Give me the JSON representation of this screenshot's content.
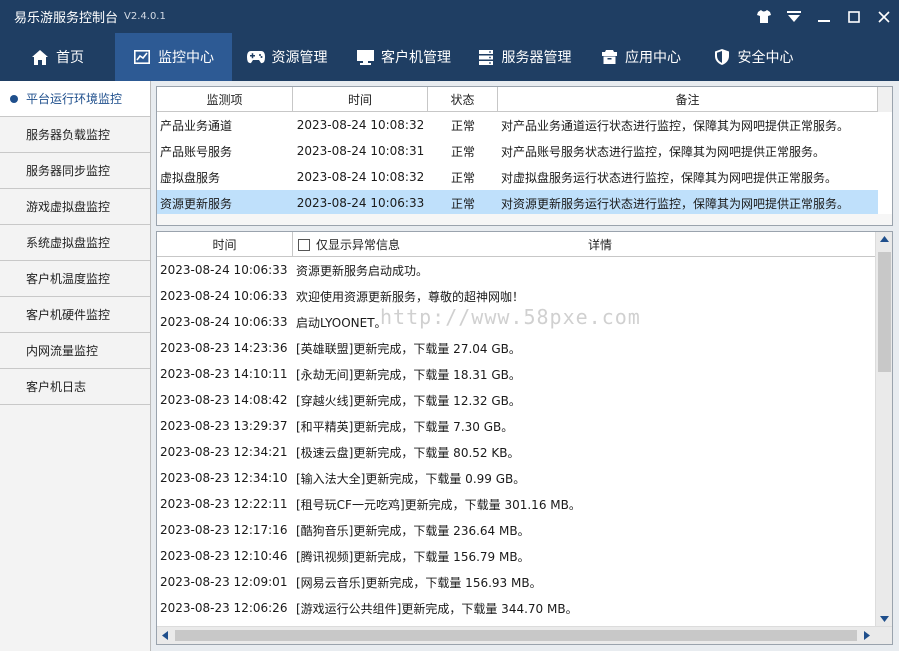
{
  "app": {
    "title": "易乐游服务控制台",
    "version": "V2.4.0.1"
  },
  "window_controls": [
    {
      "name": "skin-icon"
    },
    {
      "name": "menu-dropdown-icon"
    },
    {
      "name": "minimize-icon"
    },
    {
      "name": "maximize-icon"
    },
    {
      "name": "close-icon"
    }
  ],
  "nav": {
    "items": [
      {
        "label": "首页",
        "icon": "home-icon"
      },
      {
        "label": "监控中心",
        "icon": "monitor-chart-icon",
        "active": true
      },
      {
        "label": "资源管理",
        "icon": "gamepad-icon"
      },
      {
        "label": "客户机管理",
        "icon": "desktop-icon"
      },
      {
        "label": "服务器管理",
        "icon": "server-icon"
      },
      {
        "label": "应用中心",
        "icon": "box-icon"
      },
      {
        "label": "安全中心",
        "icon": "shield-icon"
      }
    ]
  },
  "sidebar": {
    "items": [
      {
        "label": "平台运行环境监控",
        "active": true
      },
      {
        "label": "服务器负载监控"
      },
      {
        "label": "服务器同步监控"
      },
      {
        "label": "游戏虚拟盘监控"
      },
      {
        "label": "系统虚拟盘监控"
      },
      {
        "label": "客户机温度监控"
      },
      {
        "label": "客户机硬件监控"
      },
      {
        "label": "内网流量监控"
      },
      {
        "label": "客户机日志"
      }
    ]
  },
  "monitor_table": {
    "columns": [
      "监测项",
      "时间",
      "状态",
      "备注"
    ],
    "rows": [
      {
        "item": "产品业务通道",
        "time": "2023-08-24 10:08:32",
        "status": "正常",
        "note": "对产品业务通道运行状态进行监控，保障其为网吧提供正常服务。"
      },
      {
        "item": "产品账号服务",
        "time": "2023-08-24 10:08:31",
        "status": "正常",
        "note": "对产品账号服务状态进行监控，保障其为网吧提供正常服务。"
      },
      {
        "item": "虚拟盘服务",
        "time": "2023-08-24 10:08:32",
        "status": "正常",
        "note": "对虚拟盘服务运行状态进行监控，保障其为网吧提供正常服务。"
      },
      {
        "item": "资源更新服务",
        "time": "2023-08-24 10:06:33",
        "status": "正常",
        "note": "对资源更新服务运行状态进行监控，保障其为网吧提供正常服务。",
        "selected": true
      }
    ]
  },
  "log_table": {
    "col_time": "时间",
    "filter_label": "仅显示异常信息",
    "filter_checked": false,
    "col_detail": "详情",
    "rows": [
      {
        "time": "2023-08-24 10:06:33",
        "detail": "资源更新服务启动成功。"
      },
      {
        "time": "2023-08-24 10:06:33",
        "detail": "欢迎使用资源更新服务，尊敬的超神网咖！"
      },
      {
        "time": "2023-08-24 10:06:33",
        "detail": "启动LYOONET。"
      },
      {
        "time": "2023-08-23 14:23:36",
        "detail": "[英雄联盟]更新完成，下载量 27.04 GB。"
      },
      {
        "time": "2023-08-23 14:10:11",
        "detail": "[永劫无间]更新完成，下载量 18.31 GB。"
      },
      {
        "time": "2023-08-23 14:08:42",
        "detail": "[穿越火线]更新完成，下载量 12.32 GB。"
      },
      {
        "time": "2023-08-23 13:29:37",
        "detail": "[和平精英]更新完成，下载量 7.30 GB。"
      },
      {
        "time": "2023-08-23 12:34:21",
        "detail": "[极速云盘]更新完成，下载量 80.52 KB。"
      },
      {
        "time": "2023-08-23 12:34:10",
        "detail": "[输入法大全]更新完成，下载量 0.99 GB。"
      },
      {
        "time": "2023-08-23 12:22:11",
        "detail": "[租号玩CF一元吃鸡]更新完成，下载量 301.16 MB。"
      },
      {
        "time": "2023-08-23 12:17:16",
        "detail": "[酷狗音乐]更新完成，下载量 236.64 MB。"
      },
      {
        "time": "2023-08-23 12:10:46",
        "detail": "[腾讯视频]更新完成，下载量 156.79 MB。"
      },
      {
        "time": "2023-08-23 12:09:01",
        "detail": "[网易云音乐]更新完成，下载量 156.93 MB。"
      },
      {
        "time": "2023-08-23 12:06:26",
        "detail": "[游戏运行公共组件]更新完成，下载量 344.70 MB。"
      }
    ]
  },
  "watermark": "http://www.58pxe.com",
  "colors": {
    "titlebar": "#1f3e63",
    "nav_active": "#2d5a94",
    "selection": "#bfe0fb",
    "sidebar_active_text": "#1f4f8c"
  }
}
